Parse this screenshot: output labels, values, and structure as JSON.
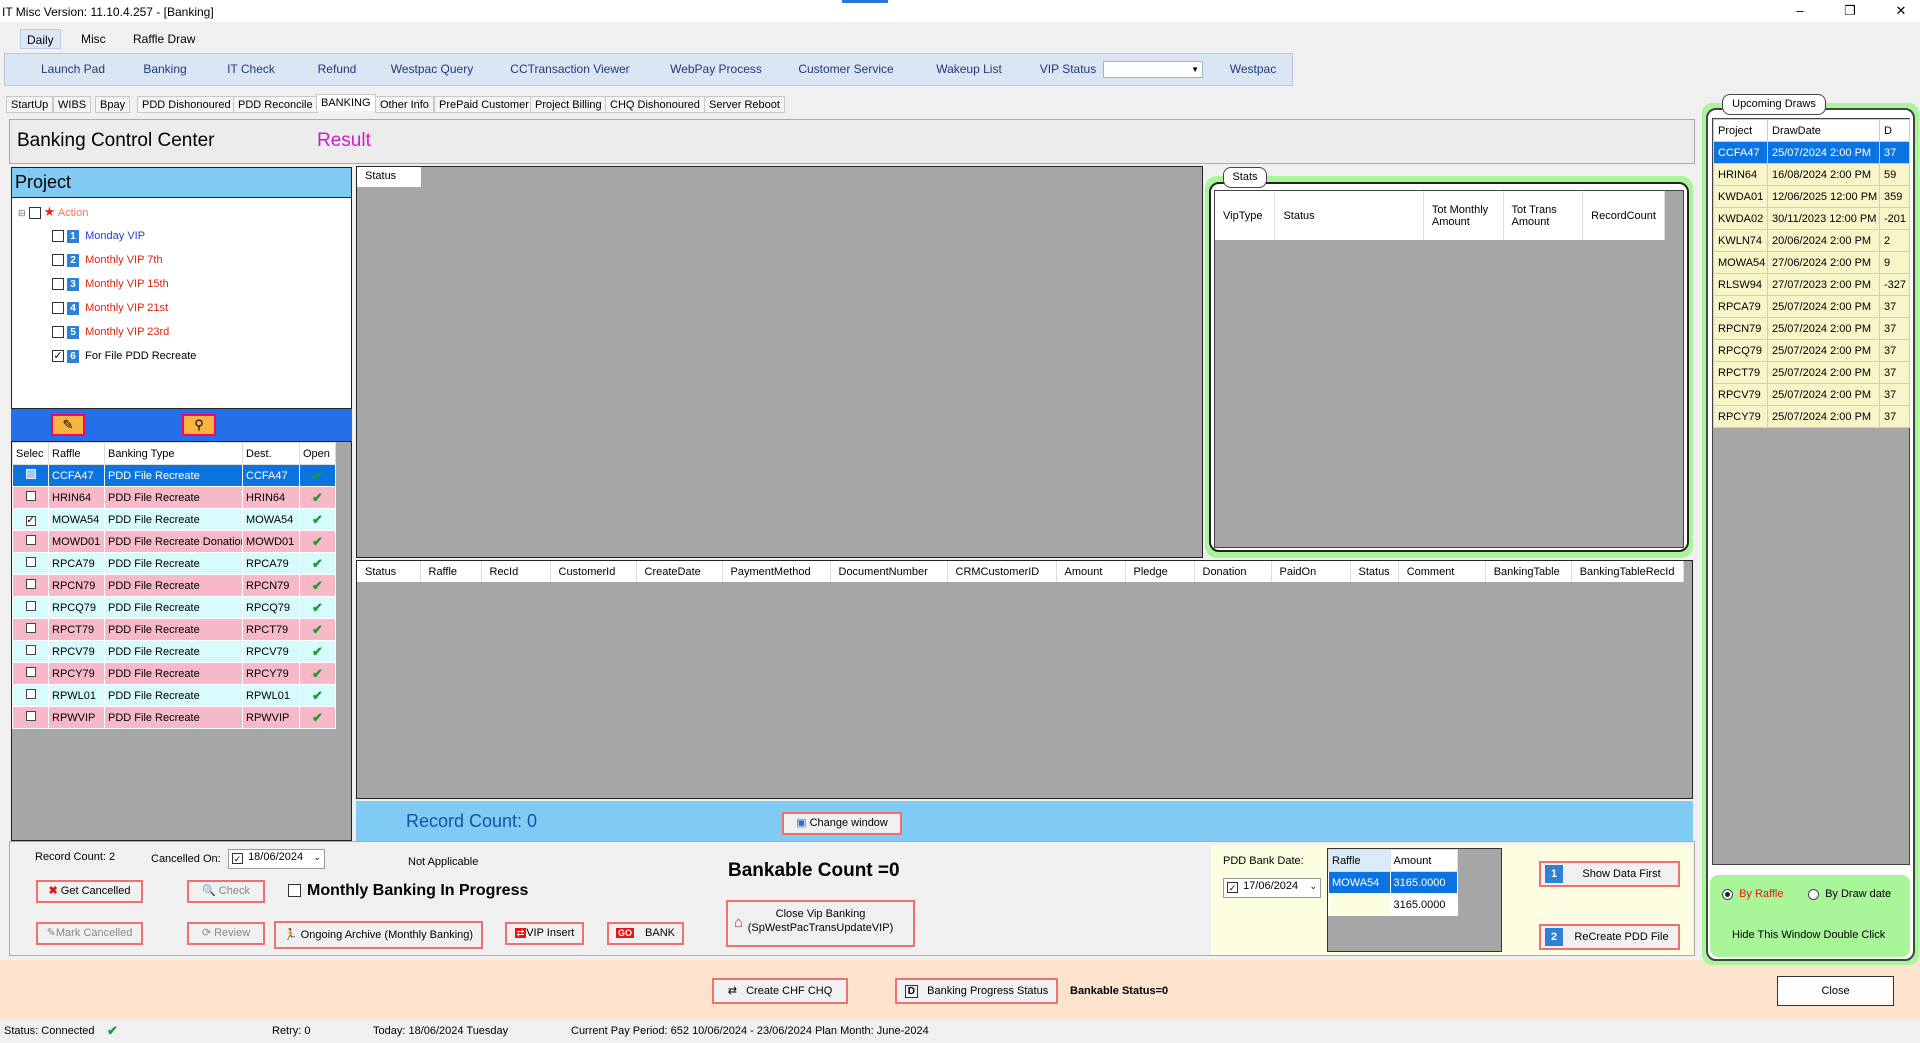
{
  "window": {
    "title": "IT Misc Version: 11.10.4.257 - [Banking]",
    "controls": [
      "–",
      "❐",
      "✕"
    ]
  },
  "menu_tabs": [
    "Daily",
    "Misc",
    "Raffle Draw"
  ],
  "toolbar": {
    "buttons": [
      "Launch Pad",
      "Banking",
      "IT Check",
      "Refund",
      "Westpac Query",
      "CCTransaction Viewer",
      "WebPay Process",
      "Customer Service",
      "Wakeup List",
      "VIP Status"
    ],
    "vip_status_value": "",
    "westpac": "Westpac"
  },
  "sub_tabs": [
    "StartUp",
    "WIBS",
    "Bpay",
    "PDD Dishonoured",
    "PDD Reconcile",
    "BANKING",
    "Other Info",
    "PrePaid Customer",
    "Project Billing",
    "CHQ Dishonoured",
    "Server Reboot"
  ],
  "header": {
    "title": "Banking Control Center",
    "result": "Result"
  },
  "project": {
    "title": "Project",
    "root": "Action",
    "items": [
      {
        "num": "1",
        "label": "Monday VIP",
        "checked": false
      },
      {
        "num": "2",
        "label": "Monthly VIP 7th",
        "checked": false
      },
      {
        "num": "3",
        "label": "Monthly VIP 15th",
        "checked": false
      },
      {
        "num": "4",
        "label": "Monthly VIP 21st",
        "checked": false
      },
      {
        "num": "5",
        "label": "Monthly VIP 23rd",
        "checked": false
      },
      {
        "num": "6",
        "label": "For File PDD Recreate",
        "checked": true
      }
    ]
  },
  "raffle_grid": {
    "columns": [
      "Selec",
      "Raffle",
      "Banking Type",
      "Dest.",
      "Open"
    ],
    "rows": [
      {
        "checked": false,
        "raffle": "CCFA47",
        "type": "PDD File Recreate",
        "dest": "CCFA47",
        "open": "✔",
        "style": "sel"
      },
      {
        "checked": false,
        "raffle": "HRIN64",
        "type": "PDD File Recreate",
        "dest": "HRIN64",
        "open": "✔",
        "style": "pink"
      },
      {
        "checked": true,
        "raffle": "MOWA54",
        "type": "PDD File Recreate",
        "dest": "MOWA54",
        "open": "✔",
        "style": "cyan"
      },
      {
        "checked": false,
        "raffle": "MOWD01",
        "type": "PDD File Recreate Donation",
        "dest": "MOWD01",
        "open": "✔",
        "style": "pink"
      },
      {
        "checked": false,
        "raffle": "RPCA79",
        "type": "PDD File Recreate",
        "dest": "RPCA79",
        "open": "✔",
        "style": "cyan"
      },
      {
        "checked": false,
        "raffle": "RPCN79",
        "type": "PDD File Recreate",
        "dest": "RPCN79",
        "open": "✔",
        "style": "pink"
      },
      {
        "checked": false,
        "raffle": "RPCQ79",
        "type": "PDD File Recreate",
        "dest": "RPCQ79",
        "open": "✔",
        "style": "cyan"
      },
      {
        "checked": false,
        "raffle": "RPCT79",
        "type": "PDD File Recreate",
        "dest": "RPCT79",
        "open": "✔",
        "style": "pink"
      },
      {
        "checked": false,
        "raffle": "RPCV79",
        "type": "PDD File Recreate",
        "dest": "RPCV79",
        "open": "✔",
        "style": "cyan"
      },
      {
        "checked": false,
        "raffle": "RPCY79",
        "type": "PDD File Recreate",
        "dest": "RPCY79",
        "open": "✔",
        "style": "pink"
      },
      {
        "checked": false,
        "raffle": "RPWL01",
        "type": "PDD File Recreate",
        "dest": "RPWL01",
        "open": "✔",
        "style": "cyan"
      },
      {
        "checked": false,
        "raffle": "RPWVIP",
        "type": "PDD File Recreate",
        "dest": "RPWVIP",
        "open": "✔",
        "style": "pink"
      }
    ]
  },
  "status_panel": {
    "label": "Status"
  },
  "stats": {
    "label": "Stats",
    "columns": [
      "VipType",
      "Status",
      "Tot Monthly Amount",
      "Tot Trans Amount",
      "RecordCount"
    ]
  },
  "main_grid": {
    "columns": [
      "Status",
      "Raffle",
      "RecId",
      "CustomerId",
      "CreateDate",
      "PaymentMethod",
      "DocumentNumber",
      "CRMCustomerID",
      "Amount",
      "Pledge",
      "Donation",
      "PaidOn",
      "Status",
      "Comment",
      "BankingTable",
      "BankingTableRecId"
    ]
  },
  "record_bar": {
    "record_count": "Record Count: 0",
    "change_window": "Change window"
  },
  "bottom": {
    "record_count": "Record Count: 2",
    "cancelled_on_label": "Cancelled On:",
    "cancelled_on_date": "18/06/2024",
    "not_applicable": "Not Applicable",
    "monthly_banking": "Monthly Banking In Progress",
    "bankable_count": "Bankable Count =0",
    "get_cancelled": "Get Cancelled",
    "check": "Check",
    "mark_cancelled": "Mark Cancelled",
    "review": "Review",
    "ongoing_archive": "Ongoing Archive (Monthly Banking)",
    "vip_insert": "VIP Insert",
    "bank": "BANK",
    "close_vip": "Close Vip Banking",
    "close_vip_sub": "(SpWestPacTransUpdateVIP)"
  },
  "pdd": {
    "label": "PDD Bank Date:",
    "date": "17/06/2024",
    "columns": [
      "Raffle",
      "Amount"
    ],
    "rows": [
      {
        "raffle": "MOWA54",
        "amount": "3165.0000"
      },
      {
        "raffle": "",
        "amount": "3165.0000"
      }
    ],
    "show_data_first": "Show Data First",
    "recreate": "ReCreate PDD File",
    "badge1": "1",
    "badge2": "2"
  },
  "footer": {
    "create_chf": "Create CHF CHQ",
    "banking_progress": "Banking Progress Status",
    "bankable_status": "Bankable Status=0",
    "close": "Close"
  },
  "statusbar": {
    "status": "Status: Connected",
    "retry": "Retry:  0",
    "today": "Today: 18/06/2024 Tuesday",
    "pay_period": "Current Pay Period: 652  10/06/2024 - 23/06/2024  Plan Month: June-2024"
  },
  "upcoming": {
    "label": "Upcoming Draws",
    "columns": [
      "Project",
      "DrawDate",
      "D"
    ],
    "rows": [
      {
        "project": "CCFA47",
        "date": "25/07/2024 2:00 PM",
        "d": "37"
      },
      {
        "project": "HRIN64",
        "date": "16/08/2024 2:00 PM",
        "d": "59"
      },
      {
        "project": "KWDA01",
        "date": "12/06/2025 12:00 PM",
        "d": "359"
      },
      {
        "project": "KWDA02",
        "date": "30/11/2023 12:00 PM",
        "d": "-201"
      },
      {
        "project": "KWLN74",
        "date": "20/06/2024 2:00 PM",
        "d": "2"
      },
      {
        "project": "MOWA54",
        "date": "27/06/2024 2:00 PM",
        "d": "9"
      },
      {
        "project": "RLSW94",
        "date": "27/07/2023 2:00 PM",
        "d": "-327"
      },
      {
        "project": "RPCA79",
        "date": "25/07/2024 2:00 PM",
        "d": "37"
      },
      {
        "project": "RPCN79",
        "date": "25/07/2024 2:00 PM",
        "d": "37"
      },
      {
        "project": "RPCQ79",
        "date": "25/07/2024 2:00 PM",
        "d": "37"
      },
      {
        "project": "RPCT79",
        "date": "25/07/2024 2:00 PM",
        "d": "37"
      },
      {
        "project": "RPCV79",
        "date": "25/07/2024 2:00 PM",
        "d": "37"
      },
      {
        "project": "RPCY79",
        "date": "25/07/2024 2:00 PM",
        "d": "37"
      }
    ],
    "by_raffle": "By Raffle",
    "by_draw_date": "By Draw date",
    "hide_hint": "Hide This Window Double Click"
  }
}
